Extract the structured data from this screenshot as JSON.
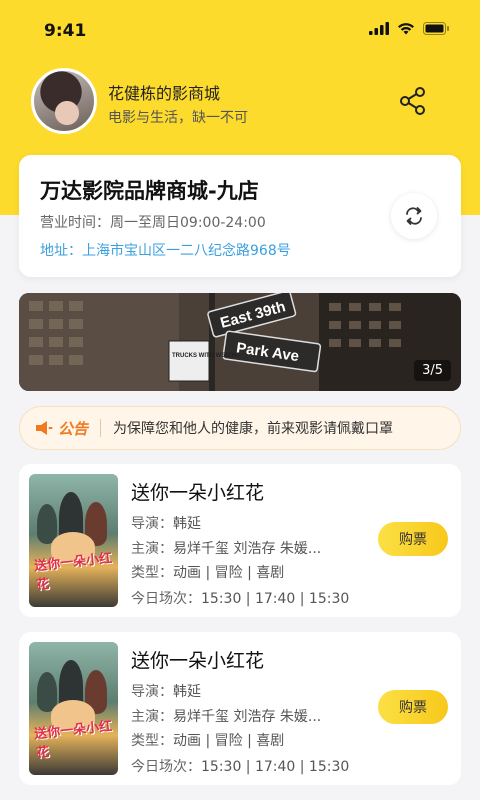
{
  "status_bar": {
    "time": "9:41"
  },
  "profile": {
    "name": "花健栋的影商城",
    "slogan": "电影与生活，缺一不可"
  },
  "store": {
    "name": "万达影院品牌商城-九店",
    "hours": "营业时间：周一至周日09:00-24:00",
    "address": "地址：上海市宝山区一二八纪念路968号"
  },
  "banner": {
    "pager": "3/5",
    "signs": [
      "East 39th",
      "Park Ave",
      "TRUCKS WITH WEIGHT"
    ]
  },
  "notice": {
    "tag": "公告",
    "text": "为保障您和他人的健康，前来观影请佩戴口罩"
  },
  "movies": [
    {
      "title": "送你一朵小红花",
      "director_label": "导演：",
      "director": "韩延",
      "cast_label": "主演：",
      "cast": "易烊千玺 刘浩存 朱媛...",
      "genre_label": "类型：",
      "genre": "动画 | 冒险 | 喜剧",
      "showtimes_label": "今日场次：",
      "showtimes": "15:30 | 17:40 | 15:30",
      "buy_label": "购票",
      "poster_caption": "送你一朵小红花"
    },
    {
      "title": "送你一朵小红花",
      "director_label": "导演：",
      "director": "韩延",
      "cast_label": "主演：",
      "cast": "易烊千玺 刘浩存 朱媛...",
      "genre_label": "类型：",
      "genre": "动画 | 冒险 | 喜剧",
      "showtimes_label": "今日场次：",
      "showtimes": "15:30 | 17:40 | 15:30",
      "buy_label": "购票",
      "poster_caption": "送你一朵小红花"
    }
  ],
  "colors": {
    "brand_yellow": "#fddb2c",
    "address_blue": "#3aa0e0",
    "notice_orange": "#f07a22"
  },
  "icons": [
    "signal-icon",
    "wifi-icon",
    "battery-icon",
    "share-icon",
    "switch-icon",
    "megaphone-icon"
  ]
}
